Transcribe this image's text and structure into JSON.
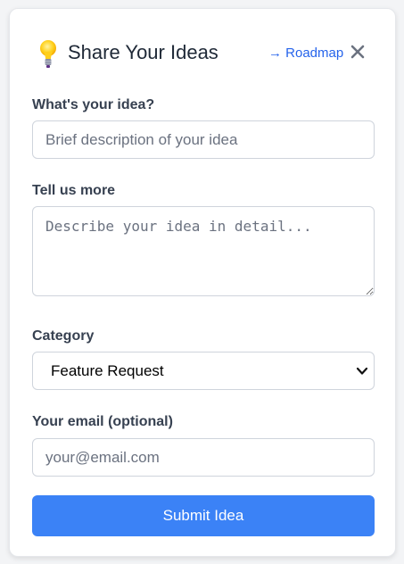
{
  "header": {
    "icon": "lightbulb-icon",
    "title": "Share Your Ideas",
    "roadmap_label": "→ Roadmap",
    "close_icon": "close-icon"
  },
  "form": {
    "idea": {
      "label": "What's your idea?",
      "placeholder": "Brief description of your idea",
      "value": ""
    },
    "details": {
      "label": "Tell us more",
      "placeholder": "Describe your idea in detail...",
      "value": ""
    },
    "category": {
      "label": "Category",
      "selected": "Feature Request"
    },
    "email": {
      "label": "Your email (optional)",
      "placeholder": "your@email.com",
      "value": ""
    },
    "submit_label": "Submit Idea"
  },
  "colors": {
    "accent": "#3b82f6",
    "link": "#2563eb",
    "label": "#374151",
    "title": "#1f2937"
  }
}
